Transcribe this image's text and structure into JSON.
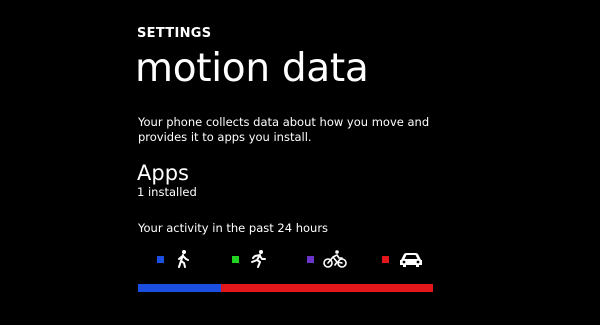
{
  "header": {
    "section": "SETTINGS",
    "title": "motion data"
  },
  "description": "Your phone collects data about how you move and provides it to apps you install.",
  "apps": {
    "title": "Apps",
    "count": "1 installed"
  },
  "activity": {
    "heading": "Your activity in the past 24 hours",
    "legend": [
      {
        "icon": "walking-icon",
        "color": "#1a4fe0"
      },
      {
        "icon": "running-icon",
        "color": "#21d321"
      },
      {
        "icon": "cycling-icon",
        "color": "#6a35c8"
      },
      {
        "icon": "car-icon",
        "color": "#e3161c"
      }
    ],
    "breakdown": [
      {
        "activity": "walking",
        "fraction": 0.28,
        "color": "#1a4fe0"
      },
      {
        "activity": "driving",
        "fraction": 0.72,
        "color": "#e3161c"
      }
    ]
  }
}
